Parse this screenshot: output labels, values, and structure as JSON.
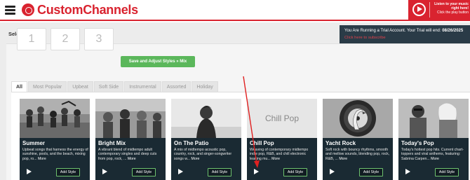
{
  "header": {
    "logo_text": "CustomChannels",
    "promo": {
      "line1": "Listen to your music",
      "line2": "right here!",
      "line3": "Click the play button"
    }
  },
  "main": {
    "section_title": "Select Styles",
    "pages": [
      "1",
      "2",
      "3"
    ],
    "save_button": "Save and Adjust Styles » Mix",
    "tabs": [
      "All",
      "Most Popular",
      "Upbeat",
      "Soft Side",
      "Instrumental",
      "Assorted",
      "Holiday"
    ],
    "active_tab": "All"
  },
  "trial": {
    "message_prefix": "You Are Running a Trial Account. Your Trial will end: ",
    "end_date": "08/26/2025",
    "link": "Click here to subscribe"
  },
  "cards": [
    {
      "title": "Summer",
      "desc": "Upbeat songs that harness the energy of sunshine, pools, and the beach, mixing pop, ro...",
      "more": "More",
      "add": "Add Style",
      "image": "summer-group-photo"
    },
    {
      "title": "Bright Mix",
      "desc": "A vibrant blend of midtempo adult contemporary singles and deep cuts from pop, rock, ...",
      "more": "More",
      "add": "Add Style",
      "image": "bright-mix-photo"
    },
    {
      "title": "On The Patio",
      "desc": "A mix of midtempo acoustic pop, country, rock, and singer-songwriter songs w...",
      "more": "More",
      "add": "Add Style",
      "image": "patio-silhouette-photo"
    },
    {
      "title": "Chill Pop",
      "desc": "Weaving of contemporary midtempo indie pop, R&B, and chill electronic leaning mu...",
      "more": "More",
      "add": "Add Style",
      "image": "chill-pop-text-tile",
      "image_text": "Chill Pop"
    },
    {
      "title": "Yacht Rock",
      "desc": "Soft rock with bouncy rhythms, smooth and mellow sounds, blending pop, rock, R&B, ...",
      "more": "More",
      "add": "Add Style",
      "image": "flamingo-record-photo"
    },
    {
      "title": "Today's Pop",
      "desc": "Today's hottest pop hits. Current chart-toppers and viral anthems, featuring: Sabrina Carpen...",
      "more": "More",
      "add": "Add Style",
      "image": "artists-photo"
    }
  ],
  "colors": {
    "brand_red": "#d9232f",
    "card_bg": "#1a2a33",
    "add_border": "#6ec26e",
    "save_green": "#5bb75b",
    "trial_bg": "#2a3b47"
  }
}
